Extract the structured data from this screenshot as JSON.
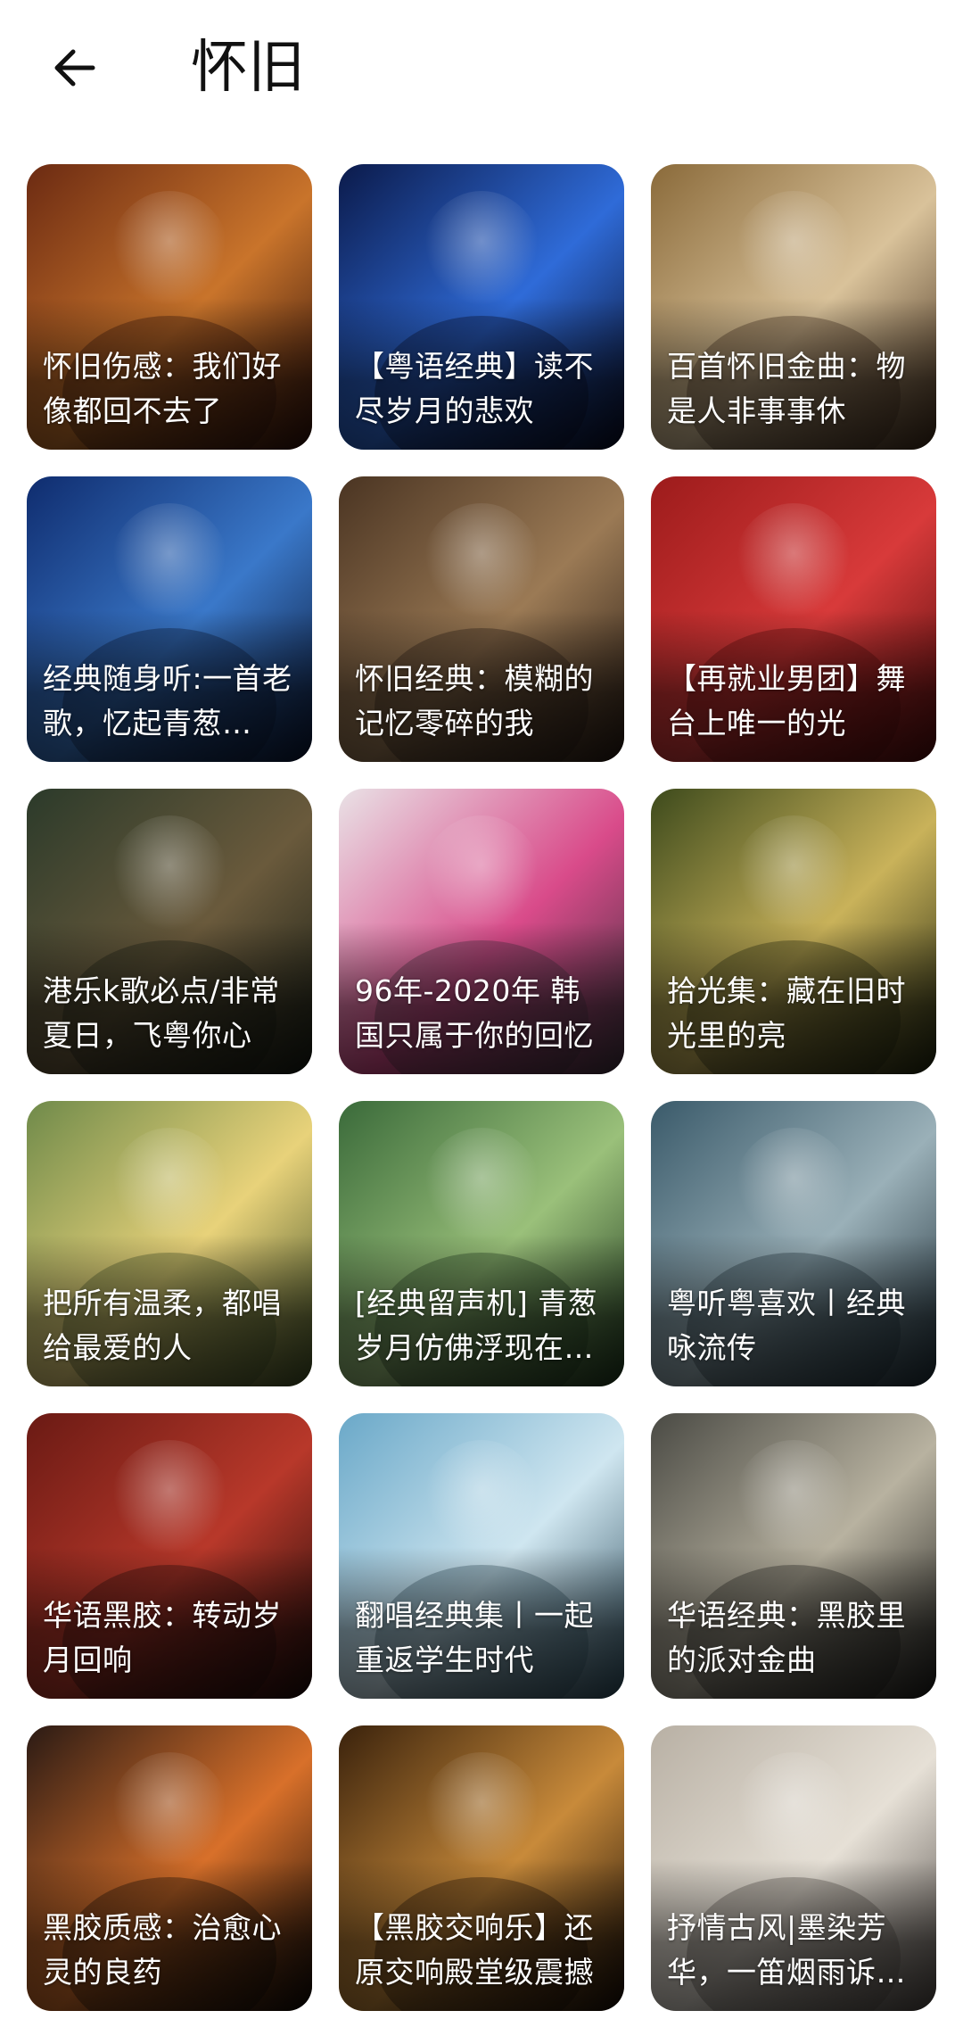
{
  "header": {
    "title": "怀旧",
    "back_icon": "arrow-left-icon"
  },
  "playlists": [
    {
      "title": "怀旧伤感：我们好像都回不去了",
      "colors": [
        "#6b2a12",
        "#c9742b",
        "#2a0d08"
      ]
    },
    {
      "title": "【粤语经典】读不尽岁月的悲欢",
      "colors": [
        "#0b1a4a",
        "#2f6bd8",
        "#06091f"
      ]
    },
    {
      "title": "百首怀旧金曲：物是人非事事休",
      "colors": [
        "#8a6a3a",
        "#d9c29a",
        "#3a2616"
      ]
    },
    {
      "title": "经典随身听:一首老歌，忆起青葱…",
      "colors": [
        "#0f2c6e",
        "#3a78c9",
        "#08132e"
      ]
    },
    {
      "title": "怀旧经典：模糊的记忆零碎的我",
      "colors": [
        "#4a3422",
        "#9b7a55",
        "#231710"
      ]
    },
    {
      "title": "【再就业男团】舞台上唯一的光",
      "colors": [
        "#9c1b1b",
        "#d83a3a",
        "#4a0a0a"
      ]
    },
    {
      "title": "港乐k歌必点/非常夏日，飞粤你心",
      "colors": [
        "#2b3a2a",
        "#6a5a3c",
        "#141a12"
      ]
    },
    {
      "title": "96年-2020年  韩国只属于你的回忆",
      "colors": [
        "#e9e2e6",
        "#d94b8a",
        "#3a2f3a"
      ]
    },
    {
      "title": "拾光集：藏在旧时光里的亮",
      "colors": [
        "#3d4a1c",
        "#c9b25a",
        "#1c220c"
      ]
    },
    {
      "title": "把所有温柔，都唱给最爱的人",
      "colors": [
        "#6f8a4a",
        "#e8d27a",
        "#3a4a22"
      ]
    },
    {
      "title": "[经典留声机] 青葱岁月仿佛浮现在…",
      "colors": [
        "#3a6a3a",
        "#9ac07a",
        "#1a331a"
      ]
    },
    {
      "title": "粤听粤喜欢丨经典咏流传",
      "colors": [
        "#3a5a6a",
        "#9ab0b8",
        "#1a2a33"
      ]
    },
    {
      "title": "华语黑胶：转动岁月回响",
      "colors": [
        "#6a1a14",
        "#b8382a",
        "#1a0a08"
      ]
    },
    {
      "title": "翻唱经典集丨一起重返学生时代",
      "colors": [
        "#6aa8c8",
        "#cfe6f0",
        "#2a4a5a"
      ]
    },
    {
      "title": "华语经典：黑胶里的派对金曲",
      "colors": [
        "#4a4a44",
        "#b8b2a0",
        "#1a1a18"
      ]
    },
    {
      "title": "黑胶质感：治愈心灵的良药",
      "colors": [
        "#2a1a14",
        "#d8702a",
        "#0a0604"
      ]
    },
    {
      "title": "【黑胶交响乐】还原交响殿堂级震撼",
      "colors": [
        "#3a220c",
        "#c88a3a",
        "#140a04"
      ]
    },
    {
      "title": "抒情古风|墨染芳华，一笛烟雨诉…",
      "colors": [
        "#b8b0a4",
        "#e6e0d6",
        "#4a4440"
      ]
    }
  ]
}
